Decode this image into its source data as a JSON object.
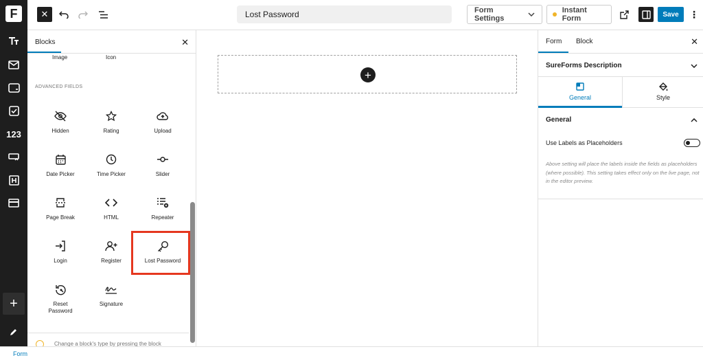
{
  "app": {
    "logo_letter": "F"
  },
  "rail": {
    "items": [
      "text-style-icon",
      "mail-icon",
      "input-icon",
      "checkbox-icon",
      "number-icon",
      "dropdown-icon",
      "heading-icon",
      "payment-icon"
    ],
    "number_label": "123",
    "add_label": "+"
  },
  "toolbar": {
    "close_label": "✕",
    "title_value": "Lost Password",
    "form_settings_label": "Form Settings",
    "instant_form_label": "Instant Form",
    "save_label": "Save",
    "more_label": "⋮",
    "instant_form_dot_color": "#f0b429",
    "accent_color": "#007cba"
  },
  "blocks": {
    "tab_label": "Blocks",
    "close_label": "✕",
    "prev_row": [
      "Image",
      "Icon"
    ],
    "section_title": "ADVANCED FIELDS",
    "items": [
      {
        "label": "Hidden",
        "icon": "eye-off-icon"
      },
      {
        "label": "Rating",
        "icon": "star-icon"
      },
      {
        "label": "Upload",
        "icon": "cloud-upload-icon"
      },
      {
        "label": "Date Picker",
        "icon": "calendar-icon"
      },
      {
        "label": "Time Picker",
        "icon": "clock-icon"
      },
      {
        "label": "Slider",
        "icon": "slider-icon"
      },
      {
        "label": "Page Break",
        "icon": "page-break-icon"
      },
      {
        "label": "HTML",
        "icon": "code-icon"
      },
      {
        "label": "Repeater",
        "icon": "repeater-icon"
      },
      {
        "label": "Login",
        "icon": "login-icon"
      },
      {
        "label": "Register",
        "icon": "user-plus-icon"
      },
      {
        "label": "Lost Password",
        "icon": "key-icon"
      },
      {
        "label": "Reset Password",
        "icon": "reset-icon"
      },
      {
        "label": "Signature",
        "icon": "signature-icon"
      }
    ],
    "highlight_color": "#e5371f",
    "tip_text": "Change a block's type by pressing the block"
  },
  "canvas": {
    "add_label": "+"
  },
  "settings": {
    "tabs": [
      "Form",
      "Block"
    ],
    "close_label": "✕",
    "description_title": "SureForms Description",
    "subtabs": [
      {
        "label": "General",
        "icon": "general-icon"
      },
      {
        "label": "Style",
        "icon": "paint-bucket-icon"
      }
    ],
    "general_title": "General",
    "toggle_label": "Use Labels as Placeholders",
    "toggle_on": false,
    "help_text": "Above setting will place the labels inside the fields as placeholders (where possible). This setting takes effect only on the live page, not in the editor preview."
  },
  "footer": {
    "breadcrumb": "Form"
  }
}
